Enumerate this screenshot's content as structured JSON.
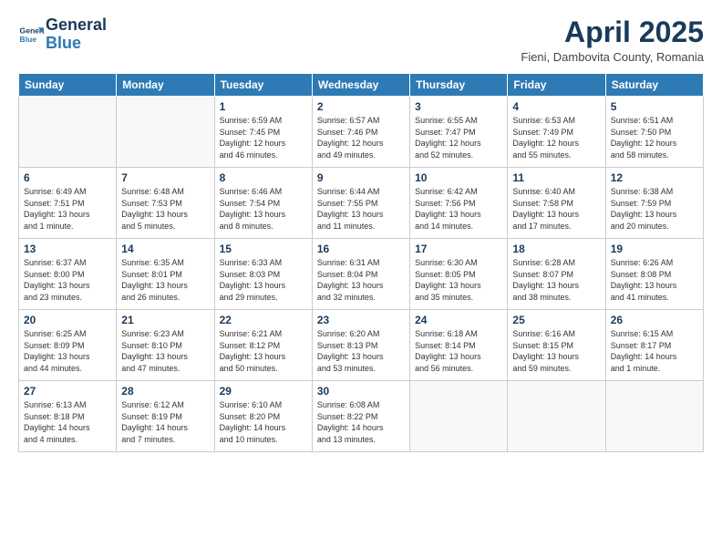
{
  "header": {
    "logo_line1": "General",
    "logo_line2": "Blue",
    "month_title": "April 2025",
    "subtitle": "Fieni, Dambovita County, Romania"
  },
  "weekdays": [
    "Sunday",
    "Monday",
    "Tuesday",
    "Wednesday",
    "Thursday",
    "Friday",
    "Saturday"
  ],
  "weeks": [
    [
      {
        "day": "",
        "info": ""
      },
      {
        "day": "",
        "info": ""
      },
      {
        "day": "1",
        "info": "Sunrise: 6:59 AM\nSunset: 7:45 PM\nDaylight: 12 hours\nand 46 minutes."
      },
      {
        "day": "2",
        "info": "Sunrise: 6:57 AM\nSunset: 7:46 PM\nDaylight: 12 hours\nand 49 minutes."
      },
      {
        "day": "3",
        "info": "Sunrise: 6:55 AM\nSunset: 7:47 PM\nDaylight: 12 hours\nand 52 minutes."
      },
      {
        "day": "4",
        "info": "Sunrise: 6:53 AM\nSunset: 7:49 PM\nDaylight: 12 hours\nand 55 minutes."
      },
      {
        "day": "5",
        "info": "Sunrise: 6:51 AM\nSunset: 7:50 PM\nDaylight: 12 hours\nand 58 minutes."
      }
    ],
    [
      {
        "day": "6",
        "info": "Sunrise: 6:49 AM\nSunset: 7:51 PM\nDaylight: 13 hours\nand 1 minute."
      },
      {
        "day": "7",
        "info": "Sunrise: 6:48 AM\nSunset: 7:53 PM\nDaylight: 13 hours\nand 5 minutes."
      },
      {
        "day": "8",
        "info": "Sunrise: 6:46 AM\nSunset: 7:54 PM\nDaylight: 13 hours\nand 8 minutes."
      },
      {
        "day": "9",
        "info": "Sunrise: 6:44 AM\nSunset: 7:55 PM\nDaylight: 13 hours\nand 11 minutes."
      },
      {
        "day": "10",
        "info": "Sunrise: 6:42 AM\nSunset: 7:56 PM\nDaylight: 13 hours\nand 14 minutes."
      },
      {
        "day": "11",
        "info": "Sunrise: 6:40 AM\nSunset: 7:58 PM\nDaylight: 13 hours\nand 17 minutes."
      },
      {
        "day": "12",
        "info": "Sunrise: 6:38 AM\nSunset: 7:59 PM\nDaylight: 13 hours\nand 20 minutes."
      }
    ],
    [
      {
        "day": "13",
        "info": "Sunrise: 6:37 AM\nSunset: 8:00 PM\nDaylight: 13 hours\nand 23 minutes."
      },
      {
        "day": "14",
        "info": "Sunrise: 6:35 AM\nSunset: 8:01 PM\nDaylight: 13 hours\nand 26 minutes."
      },
      {
        "day": "15",
        "info": "Sunrise: 6:33 AM\nSunset: 8:03 PM\nDaylight: 13 hours\nand 29 minutes."
      },
      {
        "day": "16",
        "info": "Sunrise: 6:31 AM\nSunset: 8:04 PM\nDaylight: 13 hours\nand 32 minutes."
      },
      {
        "day": "17",
        "info": "Sunrise: 6:30 AM\nSunset: 8:05 PM\nDaylight: 13 hours\nand 35 minutes."
      },
      {
        "day": "18",
        "info": "Sunrise: 6:28 AM\nSunset: 8:07 PM\nDaylight: 13 hours\nand 38 minutes."
      },
      {
        "day": "19",
        "info": "Sunrise: 6:26 AM\nSunset: 8:08 PM\nDaylight: 13 hours\nand 41 minutes."
      }
    ],
    [
      {
        "day": "20",
        "info": "Sunrise: 6:25 AM\nSunset: 8:09 PM\nDaylight: 13 hours\nand 44 minutes."
      },
      {
        "day": "21",
        "info": "Sunrise: 6:23 AM\nSunset: 8:10 PM\nDaylight: 13 hours\nand 47 minutes."
      },
      {
        "day": "22",
        "info": "Sunrise: 6:21 AM\nSunset: 8:12 PM\nDaylight: 13 hours\nand 50 minutes."
      },
      {
        "day": "23",
        "info": "Sunrise: 6:20 AM\nSunset: 8:13 PM\nDaylight: 13 hours\nand 53 minutes."
      },
      {
        "day": "24",
        "info": "Sunrise: 6:18 AM\nSunset: 8:14 PM\nDaylight: 13 hours\nand 56 minutes."
      },
      {
        "day": "25",
        "info": "Sunrise: 6:16 AM\nSunset: 8:15 PM\nDaylight: 13 hours\nand 59 minutes."
      },
      {
        "day": "26",
        "info": "Sunrise: 6:15 AM\nSunset: 8:17 PM\nDaylight: 14 hours\nand 1 minute."
      }
    ],
    [
      {
        "day": "27",
        "info": "Sunrise: 6:13 AM\nSunset: 8:18 PM\nDaylight: 14 hours\nand 4 minutes."
      },
      {
        "day": "28",
        "info": "Sunrise: 6:12 AM\nSunset: 8:19 PM\nDaylight: 14 hours\nand 7 minutes."
      },
      {
        "day": "29",
        "info": "Sunrise: 6:10 AM\nSunset: 8:20 PM\nDaylight: 14 hours\nand 10 minutes."
      },
      {
        "day": "30",
        "info": "Sunrise: 6:08 AM\nSunset: 8:22 PM\nDaylight: 14 hours\nand 13 minutes."
      },
      {
        "day": "",
        "info": ""
      },
      {
        "day": "",
        "info": ""
      },
      {
        "day": "",
        "info": ""
      }
    ]
  ]
}
